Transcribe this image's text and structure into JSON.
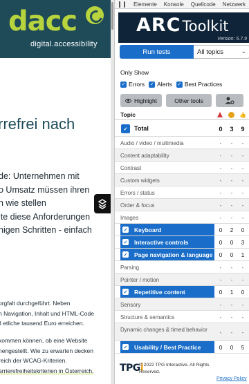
{
  "website": {
    "logo_text": "dacc",
    "tagline": "digital.accessibility",
    "heading": "rrefrei nach",
    "paragraph_lines": [
      "de: Unternehmen mit",
      "o Umsatz müssen ihren",
      "n wie stellen",
      "ite diese Anforderungen",
      "nigen Schritten - einfach"
    ],
    "small_text_1": [
      "orgfalt durchgeführt. Neben",
      "n Navigation, Inhalt und HTML-Code",
      "ll etliche tausend Euro erreichen."
    ],
    "small_text_2": [
      "kommen können, ob eine Website",
      "nengestellt. Wie zu erwarten decken",
      "reich der WCAG-Kriterien."
    ],
    "small_link": "arrierefreiheitskriterien in Österreich."
  },
  "devtools": {
    "tabs": [
      "Elemente",
      "Konsole",
      "Quellcode",
      "Netzwerk"
    ]
  },
  "arc": {
    "title_main": "ARC",
    "title_sub": "Toolkit",
    "version": "Version: 5.7.9",
    "run_button": "Run tests",
    "topics_select": "All topics",
    "only_show_label": "Only Show",
    "filters": [
      "Errors",
      "Alerts",
      "Best Practices"
    ],
    "highlight_button": "Highlight",
    "other_tools_button": "Other tools",
    "table_header": "Topic",
    "total": {
      "label": "Total",
      "errors": "0",
      "alerts": "3",
      "best": "9"
    },
    "rows": [
      {
        "label": "Audio / video / multimedia",
        "errors": "-",
        "alerts": "-",
        "best": "-",
        "type": "plain"
      },
      {
        "label": "Content adaptability",
        "errors": "-",
        "alerts": "-",
        "best": "-",
        "type": "plain"
      },
      {
        "label": "Contrast",
        "errors": "-",
        "alerts": "-",
        "best": "-",
        "type": "plain"
      },
      {
        "label": "Custom widgets",
        "errors": "-",
        "alerts": "-",
        "best": "-",
        "type": "plain"
      },
      {
        "label": "Errors / status",
        "errors": "-",
        "alerts": "-",
        "best": "-",
        "type": "plain"
      },
      {
        "label": "Order & focus",
        "errors": "-",
        "alerts": "-",
        "best": "-",
        "type": "plain"
      },
      {
        "label": "Images",
        "errors": "-",
        "alerts": "-",
        "best": "-",
        "type": "plain"
      },
      {
        "label": "Keyboard",
        "errors": "0",
        "alerts": "2",
        "best": "0",
        "type": "section"
      },
      {
        "label": "Interactive controls",
        "errors": "0",
        "alerts": "0",
        "best": "3",
        "type": "section"
      },
      {
        "label": "Page navigation & language",
        "errors": "0",
        "alerts": "0",
        "best": "1",
        "type": "section"
      },
      {
        "label": "Parsing",
        "errors": "-",
        "alerts": "-",
        "best": "-",
        "type": "plain"
      },
      {
        "label": "Pointer / motion",
        "errors": "-",
        "alerts": "-",
        "best": "-",
        "type": "plain"
      },
      {
        "label": "Repetitive content",
        "errors": "0",
        "alerts": "1",
        "best": "0",
        "type": "section"
      },
      {
        "label": "Sensory",
        "errors": "-",
        "alerts": "-",
        "best": "-",
        "type": "plain"
      },
      {
        "label": "Structure & semantics",
        "errors": "-",
        "alerts": "-",
        "best": "-",
        "type": "plain"
      },
      {
        "label": "Dynamic changes & timed behavior",
        "errors": "-",
        "alerts": "-",
        "best": "-",
        "type": "tall"
      },
      {
        "label": "Usability / Best Practice",
        "errors": "0",
        "alerts": "0",
        "best": "5",
        "type": "section"
      }
    ],
    "footer": {
      "logo": "TPGi",
      "copyright_line1": "© 2022 TPG Interactive. All Rights",
      "copyright_line2": "Reserved.",
      "privacy_link": "Privacy Policy"
    },
    "colors": {
      "brand": "#0f2339",
      "accent": "#1a6ec9",
      "error": "#d23a3a",
      "alert": "#e6a31a",
      "best": "#3a8a3a"
    }
  }
}
